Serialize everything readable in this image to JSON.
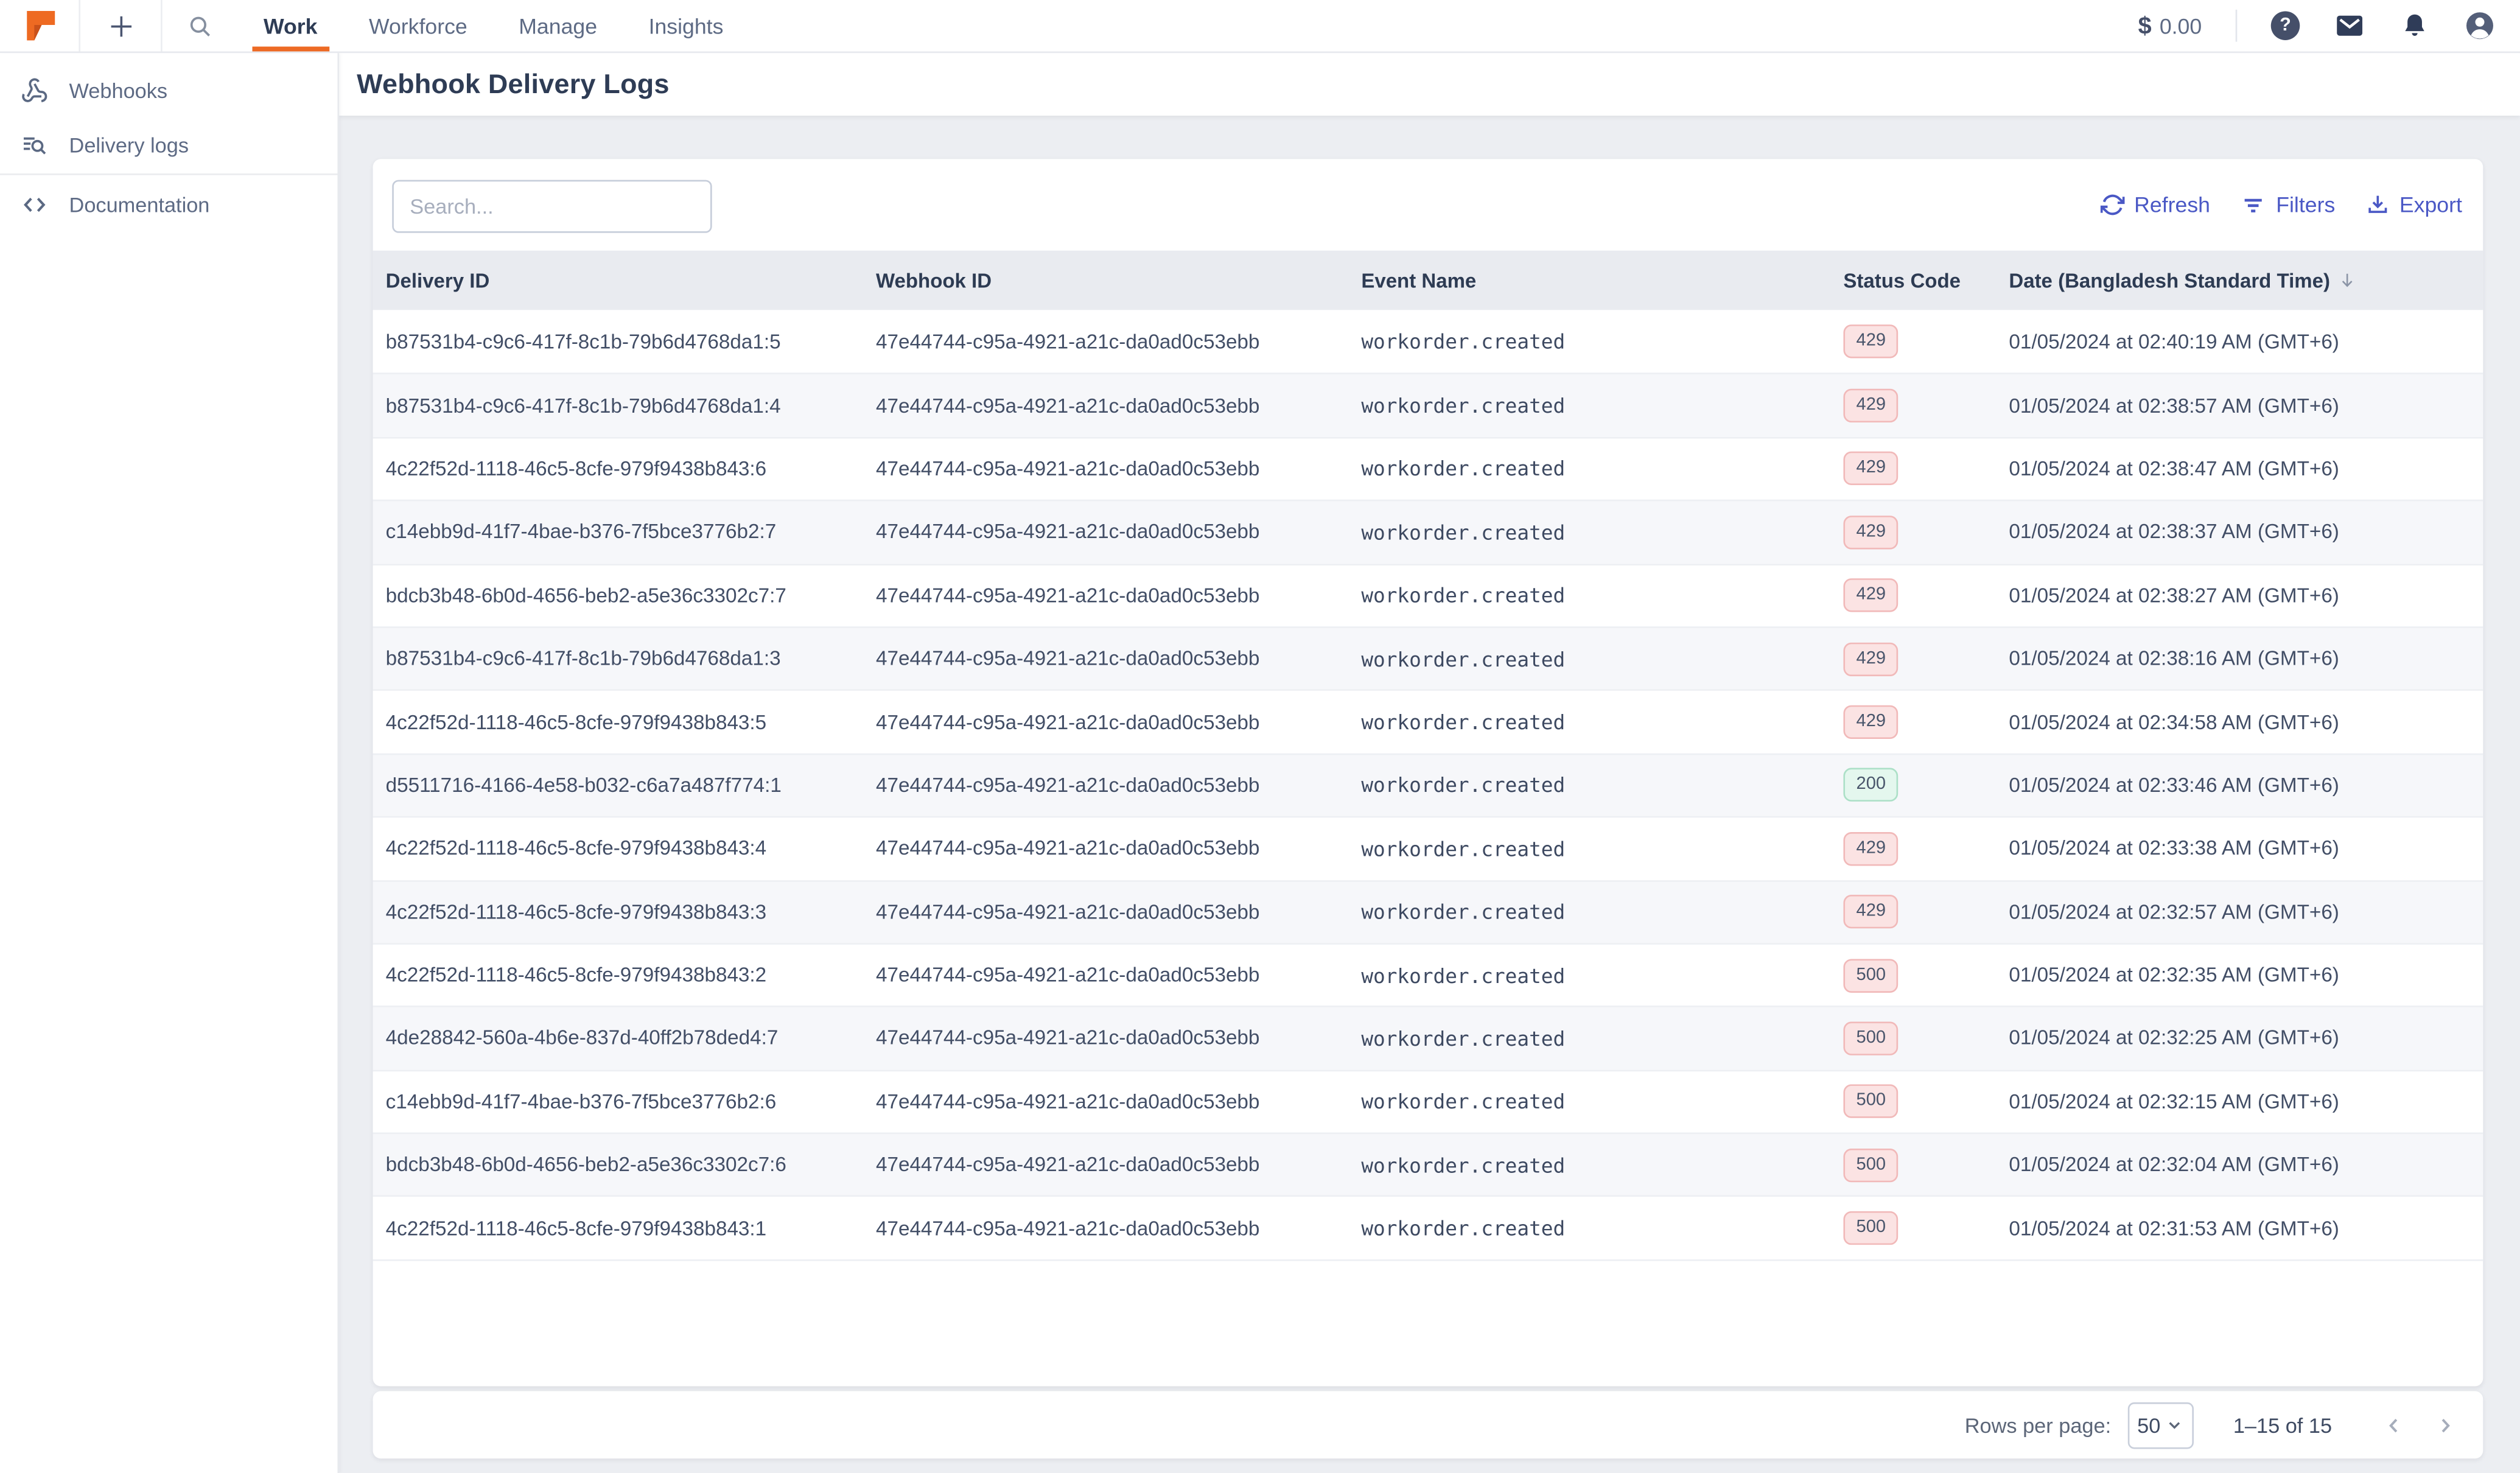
{
  "topbar": {
    "nav": [
      {
        "label": "Work",
        "active": true
      },
      {
        "label": "Workforce",
        "active": false
      },
      {
        "label": "Manage",
        "active": false
      },
      {
        "label": "Insights",
        "active": false
      }
    ],
    "balance": {
      "currency_symbol": "$",
      "amount": "0.00"
    },
    "help_glyph": "?"
  },
  "sidebar": {
    "items": [
      {
        "label": "Webhooks",
        "icon": "webhook-icon"
      },
      {
        "label": "Delivery logs",
        "icon": "list-search-icon"
      },
      {
        "label": "Documentation",
        "icon": "code-icon"
      }
    ]
  },
  "page": {
    "title": "Webhook Delivery Logs"
  },
  "toolbar": {
    "search_placeholder": "Search...",
    "refresh_label": "Refresh",
    "filters_label": "Filters",
    "export_label": "Export"
  },
  "table": {
    "columns": [
      "Delivery ID",
      "Webhook ID",
      "Event Name",
      "Status Code",
      "Date (Bangladesh Standard Time)"
    ],
    "sort": {
      "column": "Date (Bangladesh Standard Time)",
      "direction": "desc"
    },
    "rows": [
      {
        "delivery_id": "b87531b4-c9c6-417f-8c1b-79b6d4768da1:5",
        "webhook_id": "47e44744-c95a-4921-a21c-da0ad0c53ebb",
        "event_name": "workorder.created",
        "status_code": "429",
        "date": "01/05/2024 at 02:40:19 AM (GMT+6)"
      },
      {
        "delivery_id": "b87531b4-c9c6-417f-8c1b-79b6d4768da1:4",
        "webhook_id": "47e44744-c95a-4921-a21c-da0ad0c53ebb",
        "event_name": "workorder.created",
        "status_code": "429",
        "date": "01/05/2024 at 02:38:57 AM (GMT+6)"
      },
      {
        "delivery_id": "4c22f52d-1118-46c5-8cfe-979f9438b843:6",
        "webhook_id": "47e44744-c95a-4921-a21c-da0ad0c53ebb",
        "event_name": "workorder.created",
        "status_code": "429",
        "date": "01/05/2024 at 02:38:47 AM (GMT+6)"
      },
      {
        "delivery_id": "c14ebb9d-41f7-4bae-b376-7f5bce3776b2:7",
        "webhook_id": "47e44744-c95a-4921-a21c-da0ad0c53ebb",
        "event_name": "workorder.created",
        "status_code": "429",
        "date": "01/05/2024 at 02:38:37 AM (GMT+6)"
      },
      {
        "delivery_id": "bdcb3b48-6b0d-4656-beb2-a5e36c3302c7:7",
        "webhook_id": "47e44744-c95a-4921-a21c-da0ad0c53ebb",
        "event_name": "workorder.created",
        "status_code": "429",
        "date": "01/05/2024 at 02:38:27 AM (GMT+6)"
      },
      {
        "delivery_id": "b87531b4-c9c6-417f-8c1b-79b6d4768da1:3",
        "webhook_id": "47e44744-c95a-4921-a21c-da0ad0c53ebb",
        "event_name": "workorder.created",
        "status_code": "429",
        "date": "01/05/2024 at 02:38:16 AM (GMT+6)"
      },
      {
        "delivery_id": "4c22f52d-1118-46c5-8cfe-979f9438b843:5",
        "webhook_id": "47e44744-c95a-4921-a21c-da0ad0c53ebb",
        "event_name": "workorder.created",
        "status_code": "429",
        "date": "01/05/2024 at 02:34:58 AM (GMT+6)"
      },
      {
        "delivery_id": "d5511716-4166-4e58-b032-c6a7a487f774:1",
        "webhook_id": "47e44744-c95a-4921-a21c-da0ad0c53ebb",
        "event_name": "workorder.created",
        "status_code": "200",
        "date": "01/05/2024 at 02:33:46 AM (GMT+6)"
      },
      {
        "delivery_id": "4c22f52d-1118-46c5-8cfe-979f9438b843:4",
        "webhook_id": "47e44744-c95a-4921-a21c-da0ad0c53ebb",
        "event_name": "workorder.created",
        "status_code": "429",
        "date": "01/05/2024 at 02:33:38 AM (GMT+6)"
      },
      {
        "delivery_id": "4c22f52d-1118-46c5-8cfe-979f9438b843:3",
        "webhook_id": "47e44744-c95a-4921-a21c-da0ad0c53ebb",
        "event_name": "workorder.created",
        "status_code": "429",
        "date": "01/05/2024 at 02:32:57 AM (GMT+6)"
      },
      {
        "delivery_id": "4c22f52d-1118-46c5-8cfe-979f9438b843:2",
        "webhook_id": "47e44744-c95a-4921-a21c-da0ad0c53ebb",
        "event_name": "workorder.created",
        "status_code": "500",
        "date": "01/05/2024 at 02:32:35 AM (GMT+6)"
      },
      {
        "delivery_id": "4de28842-560a-4b6e-837d-40ff2b78ded4:7",
        "webhook_id": "47e44744-c95a-4921-a21c-da0ad0c53ebb",
        "event_name": "workorder.created",
        "status_code": "500",
        "date": "01/05/2024 at 02:32:25 AM (GMT+6)"
      },
      {
        "delivery_id": "c14ebb9d-41f7-4bae-b376-7f5bce3776b2:6",
        "webhook_id": "47e44744-c95a-4921-a21c-da0ad0c53ebb",
        "event_name": "workorder.created",
        "status_code": "500",
        "date": "01/05/2024 at 02:32:15 AM (GMT+6)"
      },
      {
        "delivery_id": "bdcb3b48-6b0d-4656-beb2-a5e36c3302c7:6",
        "webhook_id": "47e44744-c95a-4921-a21c-da0ad0c53ebb",
        "event_name": "workorder.created",
        "status_code": "500",
        "date": "01/05/2024 at 02:32:04 AM (GMT+6)"
      },
      {
        "delivery_id": "4c22f52d-1118-46c5-8cfe-979f9438b843:1",
        "webhook_id": "47e44744-c95a-4921-a21c-da0ad0c53ebb",
        "event_name": "workorder.created",
        "status_code": "500",
        "date": "01/05/2024 at 02:31:53 AM (GMT+6)"
      }
    ]
  },
  "footer": {
    "rows_per_page_label": "Rows per page:",
    "rows_per_page_value": "50",
    "range_label": "1–15 of 15"
  },
  "colors": {
    "accent_orange": "#ed6a24",
    "action_blue": "#4a58c5",
    "icon_dark": "#454f69",
    "text_dark": "#2e3c55",
    "text_muted": "#5d6a84",
    "content_bg": "#eceef2",
    "table_header_bg": "#e9ebf0",
    "row_alt_bg": "#f6f7fa",
    "status_error_bg": "#fbe3e3",
    "status_error_border": "#f1b9b9",
    "status_success_bg": "#e4f7ee",
    "status_success_border": "#ace0c7"
  }
}
